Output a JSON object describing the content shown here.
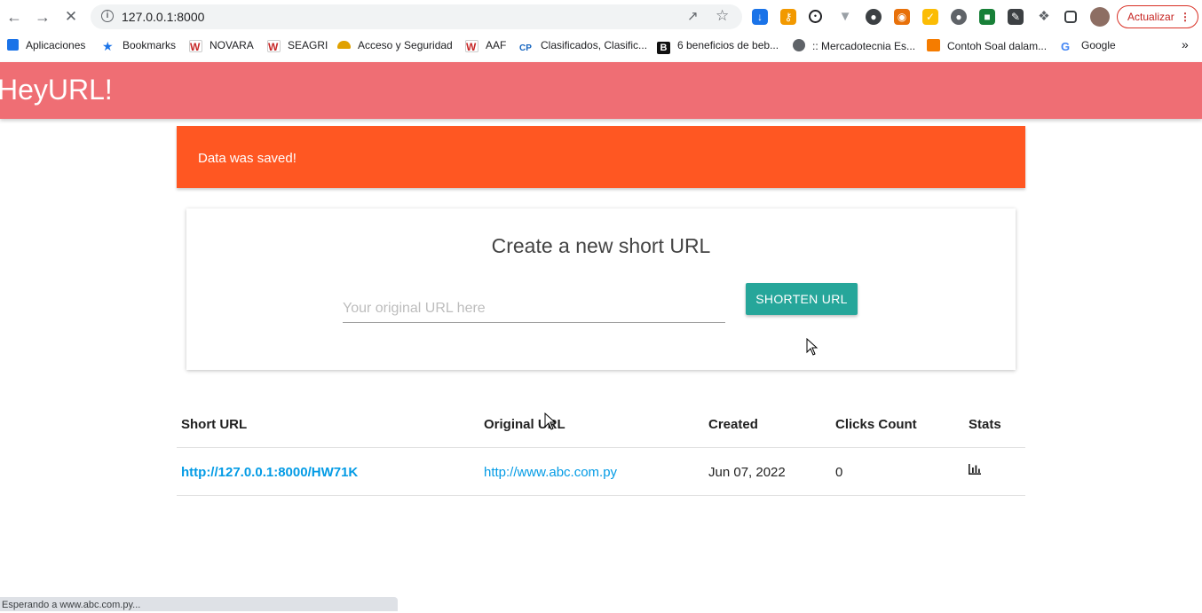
{
  "browser": {
    "url": "127.0.0.1:8000",
    "update_label": "Actualizar",
    "bookmarks": [
      {
        "label": "Aplicaciones",
        "icon": "apps-grid-icon",
        "color": "#1a73e8"
      },
      {
        "label": "Bookmarks",
        "icon": "star-icon",
        "color": "#1a73e8"
      },
      {
        "label": "NOVARA",
        "icon": "w-logo-icon",
        "color": "#c62828"
      },
      {
        "label": "SEAGRI",
        "icon": "w-logo-icon",
        "color": "#c62828"
      },
      {
        "label": "Acceso y Seguridad",
        "icon": "helmet-icon",
        "color": "#e0a100"
      },
      {
        "label": "AAF",
        "icon": "w-logo-icon",
        "color": "#c62828"
      },
      {
        "label": "Clasificados, Clasific...",
        "icon": "cp-logo-icon",
        "color": "#1565c0"
      },
      {
        "label": "6 beneficios de beb...",
        "icon": "b-logo-icon",
        "color": "#111111"
      },
      {
        "label": ":: Mercadotecnia Es...",
        "icon": "globe-icon",
        "color": "#5f6368"
      },
      {
        "label": "Contoh Soal dalam...",
        "icon": "blogger-icon",
        "color": "#f57c00"
      },
      {
        "label": "Google",
        "icon": "google-icon",
        "color": "#4285f4"
      }
    ],
    "status_text": "Esperando a www.abc.com.py..."
  },
  "header": {
    "brand": "HeyURL!"
  },
  "alert": {
    "message": "Data was saved!",
    "color": "#ff5722"
  },
  "form": {
    "title": "Create a new short URL",
    "input_placeholder": "Your original URL here",
    "input_value": "",
    "button_label": "SHORTEN URL",
    "button_color": "#26a69a"
  },
  "table": {
    "headers": [
      "Short URL",
      "Original URL",
      "Created",
      "Clicks Count",
      "Stats"
    ],
    "rows": [
      {
        "short_url": "http://127.0.0.1:8000/HW71K",
        "original_url": "http://www.abc.com.py",
        "created": "Jun 07, 2022",
        "clicks": "0",
        "stats_icon": "bar-chart-icon"
      }
    ]
  },
  "colors": {
    "header_bg": "#ef6e74",
    "link": "#039be5"
  }
}
